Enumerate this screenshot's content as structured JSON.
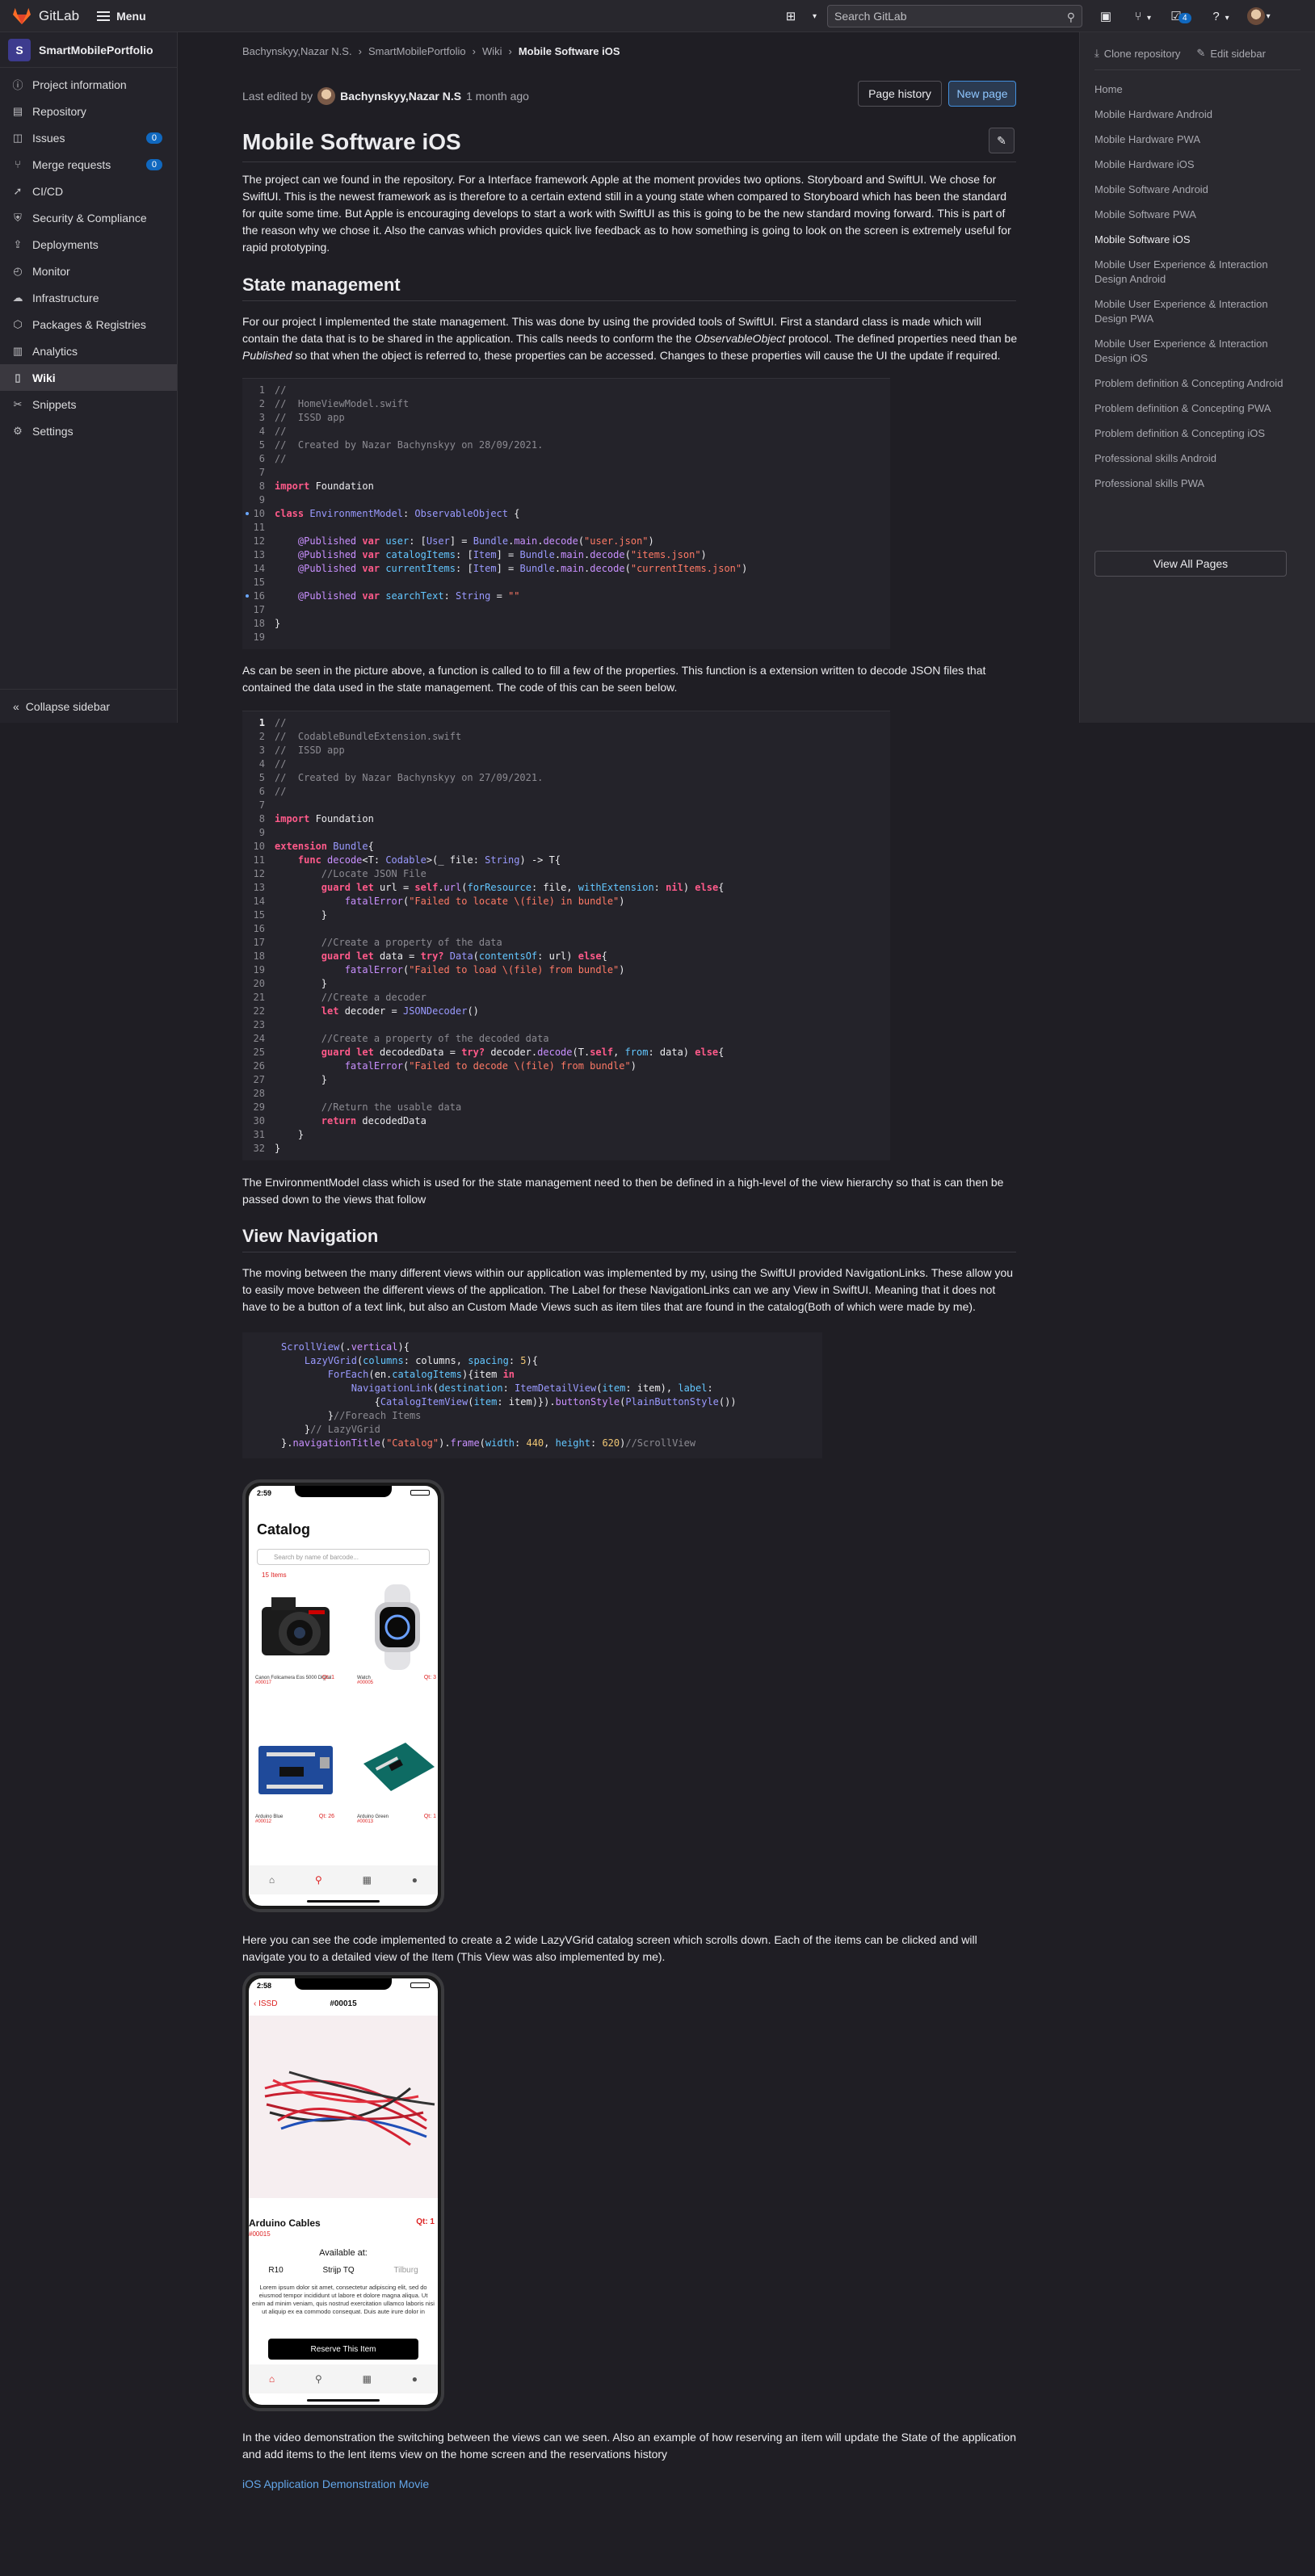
{
  "topbar": {
    "brand": "GitLab",
    "menu": "Menu",
    "search_placeholder": "Search GitLab",
    "todo_count": "4"
  },
  "sidebar": {
    "project_initial": "S",
    "project_name": "SmartMobilePortfolio",
    "items": [
      {
        "label": "Project information",
        "icon": "info-icon"
      },
      {
        "label": "Repository",
        "icon": "doc-icon"
      },
      {
        "label": "Issues",
        "icon": "issues-icon",
        "badge": "0"
      },
      {
        "label": "Merge requests",
        "icon": "merge-icon",
        "badge": "0"
      },
      {
        "label": "CI/CD",
        "icon": "rocket-icon"
      },
      {
        "label": "Security & Compliance",
        "icon": "shield-icon"
      },
      {
        "label": "Deployments",
        "icon": "deploy-icon"
      },
      {
        "label": "Monitor",
        "icon": "monitor-icon"
      },
      {
        "label": "Infrastructure",
        "icon": "cloud-icon"
      },
      {
        "label": "Packages & Registries",
        "icon": "package-icon"
      },
      {
        "label": "Analytics",
        "icon": "chart-icon"
      },
      {
        "label": "Wiki",
        "icon": "book-icon",
        "active": true
      },
      {
        "label": "Snippets",
        "icon": "snippet-icon"
      },
      {
        "label": "Settings",
        "icon": "gear-icon"
      }
    ],
    "collapse": "Collapse sidebar"
  },
  "breadcrumb": [
    "Bachynskyy,Nazar N.S.",
    "SmartMobilePortfolio",
    "Wiki",
    "Mobile Software iOS"
  ],
  "last_edited": {
    "prefix": "Last edited by",
    "author": "Bachynskyy,Nazar N.S",
    "when": "1 month ago"
  },
  "buttons": {
    "page_history": "Page history",
    "new_page": "New page"
  },
  "title": "Mobile Software iOS",
  "intro": "The project can we found in the repository. For a Interface framework Apple at the moment provides two options. Storyboard and SwiftUI. We chose for SwiftUI. This is the newest framework as is therefore to a certain extend still in a young state when compared to Storyboard which has been the standard for quite some time. But Apple is encouraging develops to start a work with SwiftUI as this is going to be the new standard moving forward. This is part of the reason why we chose it. Also the canvas which provides quick live feedback as to how something is going to look on the screen is extremely useful for rapid prototyping.",
  "state_heading": "State management",
  "state_para_1": "For our project I implemented the state management. This was done by using the provided tools of SwiftUI. First a standard class is made which will contain the data that is to be shared in the application. This calls needs to conform the the ",
  "state_para_em1": "ObservableObject",
  "state_para_2": " protocol. The defined properties need than be ",
  "state_para_em2": "Published",
  "state_para_3": " so that when the object is referred to, these properties can be accessed. Changes to these properties will cause the UI the update if required.",
  "after_code1": "As can be seen in the picture above, a function is called to to fill a few of the properties. This function is a extension written to decode JSON files that contained the data used in the state management. The code of this can be seen below.",
  "after_code2": "The EnvironmentModel class which is used for the state management need to then be defined in a high-level of the view hierarchy so that is can then be passed down to the views that follow",
  "nav_heading": "View Navigation",
  "nav_para": "The moving between the many different views within our application was implemented by my, using the SwiftUI provided NavigationLinks. These allow you to easily move between the different views of the application. The Label for these NavigationLinks can we any View in SwiftUI. Meaning that it does not have to be a button of a text link, but also an Custom Made Views such as item tiles that are found in the catalog(Both of which were made by me).",
  "catalog_phone": {
    "time": "2:59",
    "title": "Catalog",
    "search": "Search by name of barcode...",
    "count": "15 Items",
    "tiles": [
      {
        "name": "Canon Folicamera Eos 5000 Digital",
        "id": "#00017",
        "qt": "Qt: 1"
      },
      {
        "name": "Watch",
        "id": "#00005",
        "qt": "Qt: 3"
      },
      {
        "name": "Arduino Blue",
        "id": "#00012",
        "qt": "Qt: 26"
      },
      {
        "name": "Arduino Green",
        "id": "#00013",
        "qt": "Qt: 1"
      }
    ]
  },
  "after_phone1": "Here you can see the code implemented to create a 2 wide LazyVGrid catalog screen which scrolls down. Each of the items can be clicked and will navigate you to a detailed view of the Item (This View was also implemented by me).",
  "detail_phone": {
    "time": "2:58",
    "back": "ISSD",
    "title": "#00015",
    "name": "Arduino Cables",
    "qt": "Qt: 1",
    "id": "#00015",
    "available": "Available at:",
    "locations": [
      "R10",
      "Strijp TQ",
      "Tilburg"
    ],
    "lorem": "Lorem ipsum dolor sit amet, consectetur adipiscing elit, sed do eiusmod tempor incididunt ut labore et dolore magna aliqua. Ut enim ad minim veniam, quis nostrud exercitation ullamco laboris nisi ut aliquip ex ea commodo consequat. Duis aute irure dolor in",
    "reserve": "Reserve This Item"
  },
  "after_phone2": "In the video demonstration the switching between the views can we seen. Also an example of how reserving an item will update the State of the application and add items to the lent items view on the home screen and the reservations history",
  "video_link": "iOS Application Demonstration Movie",
  "right_sidebar": {
    "clone": "Clone repository",
    "edit": "Edit sidebar",
    "pages": [
      "Home",
      "Mobile Hardware Android",
      "Mobile Hardware PWA",
      "Mobile Hardware iOS",
      "Mobile Software Android",
      "Mobile Software PWA",
      "Mobile Software iOS",
      "Mobile User Experience & Interaction Design Android",
      "Mobile User Experience & Interaction Design PWA",
      "Mobile User Experience & Interaction Design iOS",
      "Problem definition & Concepting Android",
      "Problem definition & Concepting PWA",
      "Problem definition & Concepting iOS",
      "Professional skills Android",
      "Professional skills PWA"
    ],
    "active_page": "Mobile Software iOS",
    "view_all": "View All Pages"
  },
  "colors": {
    "link": "#63a6e9",
    "badge": "#1068bf",
    "bg": "#1f1e24"
  }
}
